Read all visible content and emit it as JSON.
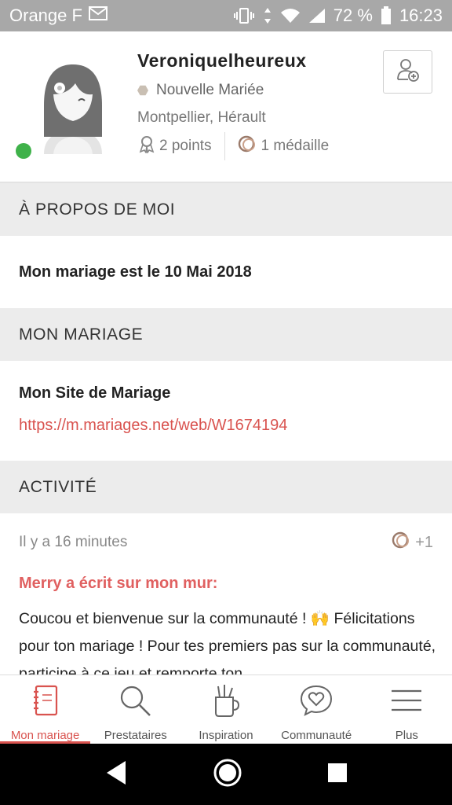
{
  "status_bar": {
    "carrier": "Orange F",
    "battery_percent": "72 %",
    "time": "16:23",
    "icons": [
      "mail-icon",
      "vibrate-icon",
      "data-arrows-icon",
      "wifi-icon",
      "signal-icon",
      "battery-icon"
    ]
  },
  "profile": {
    "username": "Veroniquelheureux",
    "role": "Nouvelle Mariée",
    "location": "Montpellier, Hérault",
    "points": "2 points",
    "medals": "1 médaille",
    "online": true,
    "colors": {
      "online": "#3fb24a",
      "accent": "#d9534f"
    }
  },
  "about": {
    "header": "À PROPOS DE MOI",
    "text": "Mon mariage est le 10 Mai 2018"
  },
  "wedding": {
    "header": "MON MARIAGE",
    "site_label": "Mon Site de Mariage",
    "site_url": "https://m.mariages.net/web/W1674194"
  },
  "activity": {
    "header": "ACTIVITÉ",
    "time_ago": "Il y a 16 minutes",
    "medal_count": "+1",
    "author_line": "Merry a écrit sur mon mur:",
    "message": "Coucou et bienvenue sur la communauté ! 🙌 Félicitations pour ton mariage ! Pour tes premiers pas sur la communauté, participe à ce jeu et remporte ton"
  },
  "tabs": [
    {
      "label": "Mon mariage",
      "icon": "notebook-icon",
      "active": true
    },
    {
      "label": "Prestataires",
      "icon": "search-icon",
      "active": false
    },
    {
      "label": "Inspiration",
      "icon": "pencil-cup-icon",
      "active": false
    },
    {
      "label": "Communauté",
      "icon": "chat-heart-icon",
      "active": false
    },
    {
      "label": "Plus",
      "icon": "menu-icon",
      "active": false
    }
  ]
}
